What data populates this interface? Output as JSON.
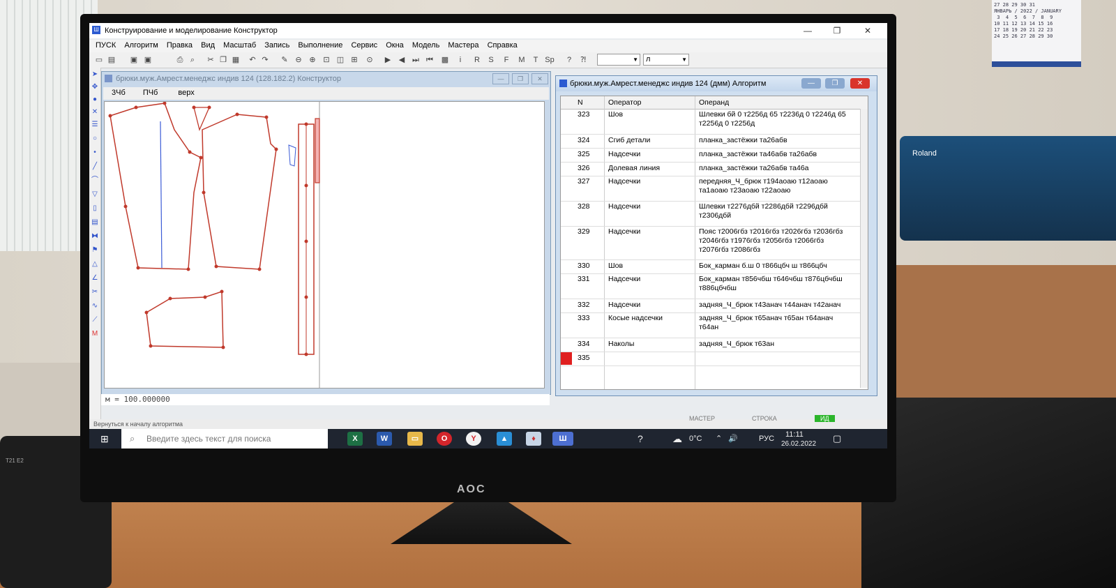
{
  "window": {
    "title": "Конструирование и моделирование  Конструктор",
    "min": "—",
    "max": "❐",
    "close": "✕"
  },
  "menu": [
    "ПУСК",
    "Алгоритм",
    "Правка",
    "Вид",
    "Масштаб",
    "Запись",
    "Выполнение",
    "Сервис",
    "Окна",
    "Модель",
    "Мастера",
    "Справка"
  ],
  "toolbar": {
    "letters": [
      "i",
      "R",
      "S",
      "F",
      "M",
      "T",
      "Sp"
    ],
    "combo1": "",
    "combo2": "л"
  },
  "constructor": {
    "title": "брюки.муж.Амрест.менеджс индив 124 (128.182.2) Конструктор",
    "tabs": [
      "3Чб",
      "ПЧб",
      "верх"
    ],
    "command": "м  = 100.000000"
  },
  "algorithm": {
    "title": "брюки.муж.Амрест.менеджс индив 124 (дмм) Алгоритм",
    "headers": {
      "n": "N",
      "operator": "Оператор",
      "operand": "Операнд"
    },
    "rows": [
      {
        "n": "323",
        "op": "Шов",
        "arg": "Шлевки бй 0 т2256д 65 т2236д 0 т2246д 65 т2256д 0 т2256д"
      },
      {
        "n": "324",
        "op": "Сгиб детали",
        "arg": "планка_застёжки та26абв"
      },
      {
        "n": "325",
        "op": "Надсечки",
        "arg": "планка_застёжки та46абв та26абв"
      },
      {
        "n": "326",
        "op": "Долевая линия",
        "arg": "планка_застёжки та26абв та46а"
      },
      {
        "n": "327",
        "op": "Надсечки",
        "arg": "передняя_Ч_брюк  т194аоаю  т12аоаю та1аоаю т23аоаю т22аоаю"
      },
      {
        "n": "328",
        "op": "Надсечки",
        "arg": "Шлевки т2276дбй т2286дбй т2296дбй т2306дбй"
      },
      {
        "n": "329",
        "op": "Надсечки",
        "arg": "Пояс т2006гбз т2016гбз т2026гбз т2036гбз т2046гбз т1976гбз т2056гбз т2066гбз т2076гбз т2086гбз"
      },
      {
        "n": "330",
        "op": "Шов",
        "arg": "Бок_карман б.ш 0 т866цбч ш т866цбч"
      },
      {
        "n": "331",
        "op": "Надсечки",
        "arg": "Бок_карман т856чбш т646чбш т876цбчбш т886цбчбш"
      },
      {
        "n": "332",
        "op": "Надсечки",
        "arg": "задняя_Ч_брюк т43анач т44анач т42анач"
      },
      {
        "n": "333",
        "op": "Косые надсечки",
        "arg": "задняя_Ч_брюк т65анач т65ан т64анач т64ан"
      },
      {
        "n": "334",
        "op": "Наколы",
        "arg": "задняя_Ч_брюк т63ан"
      },
      {
        "n": "335",
        "op": "",
        "arg": ""
      }
    ]
  },
  "status": {
    "hint": "Вернуться к началу алгоритма",
    "master": "МАСТЕР",
    "row": "СТРОКА",
    "ready": "ИД"
  },
  "taskbar": {
    "search_placeholder": "Введите здесь текст для поиска",
    "temp": "0°C",
    "lang": "РУС",
    "time": "11:11",
    "date": "26.02.2022"
  },
  "environment": {
    "monitor_brand": "AOC",
    "plotter_brand": "Roland",
    "phone_label": "T21 E2",
    "calendar": "ЯНВАРЬ / 2022 / JANUARY"
  },
  "colors": {
    "accent": "#2c5bd1",
    "pattern": "#d33b3b",
    "close": "#d9342b",
    "ready": "#2bb52b"
  }
}
